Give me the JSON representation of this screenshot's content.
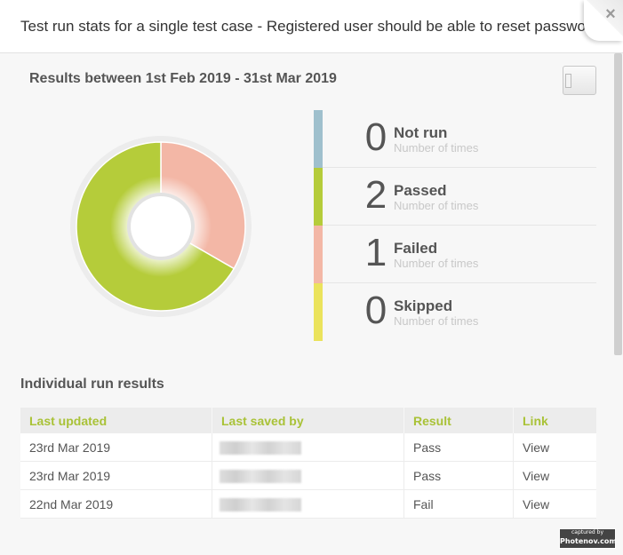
{
  "dialog": {
    "title": "Test run stats for a single test case - Registered user should be able to reset password"
  },
  "results": {
    "heading": "Results between 1st Feb 2019 - 31st Mar 2019"
  },
  "legend": [
    {
      "count": "0",
      "label": "Not run",
      "sublabel": "Number of times",
      "color": "#9fc0cd"
    },
    {
      "count": "2",
      "label": "Passed",
      "sublabel": "Number of times",
      "color": "#b5cc3a"
    },
    {
      "count": "1",
      "label": "Failed",
      "sublabel": "Number of times",
      "color": "#f3b7a6"
    },
    {
      "count": "0",
      "label": "Skipped",
      "sublabel": "Number of times",
      "color": "#ebe35c"
    }
  ],
  "chart_data": {
    "type": "pie",
    "categories": [
      "Not run",
      "Passed",
      "Failed",
      "Skipped"
    ],
    "values": [
      0,
      2,
      1,
      0
    ],
    "colors": [
      "#9fc0cd",
      "#b5cc3a",
      "#f3b7a6",
      "#ebe35c"
    ],
    "style": "donut"
  },
  "runs": {
    "heading": "Individual run results",
    "columns": [
      "Last updated",
      "Last saved by",
      "Result",
      "Link"
    ],
    "rows": [
      {
        "updated": "23rd Mar 2019",
        "result": "Pass",
        "link": "View"
      },
      {
        "updated": "23rd Mar 2019",
        "result": "Pass",
        "link": "View"
      },
      {
        "updated": "22nd Mar 2019",
        "result": "Fail",
        "link": "View"
      }
    ]
  },
  "watermark": {
    "line1": "captured by",
    "line2": "Photenov.com"
  }
}
